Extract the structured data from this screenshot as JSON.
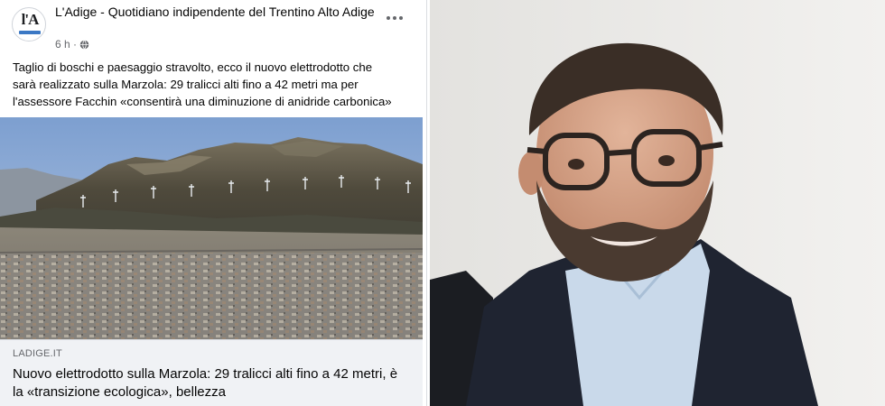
{
  "post": {
    "page_name": "L'Adige - Quotidiano indipendente del Trentino Alto Adige",
    "avatar_logo": "l'A",
    "time": "6 h ·",
    "text_lines": [
      "Taglio di boschi e paesaggio stravolto, ecco il nuovo elettrodotto che",
      "sarà realizzato sulla Marzola: 29 tralicci alti fino a 42 metri ma per",
      "l'assessore Facchin «consentirà una diminuzione di anidride carbonica»"
    ],
    "link": {
      "domain": "LADIGE.IT",
      "title": "Nuovo elettrodotto sulla Marzola: 29 tralicci alti fino a 42 metri, è la «transizione ecologica», bellezza"
    }
  },
  "icons": {
    "globe": "globe-icon",
    "more": "more-options-icon"
  },
  "colors": {
    "text_primary": "#050505",
    "text_secondary": "#65676b",
    "preview_bg": "#f0f2f5",
    "sky": "#87a6cf"
  }
}
